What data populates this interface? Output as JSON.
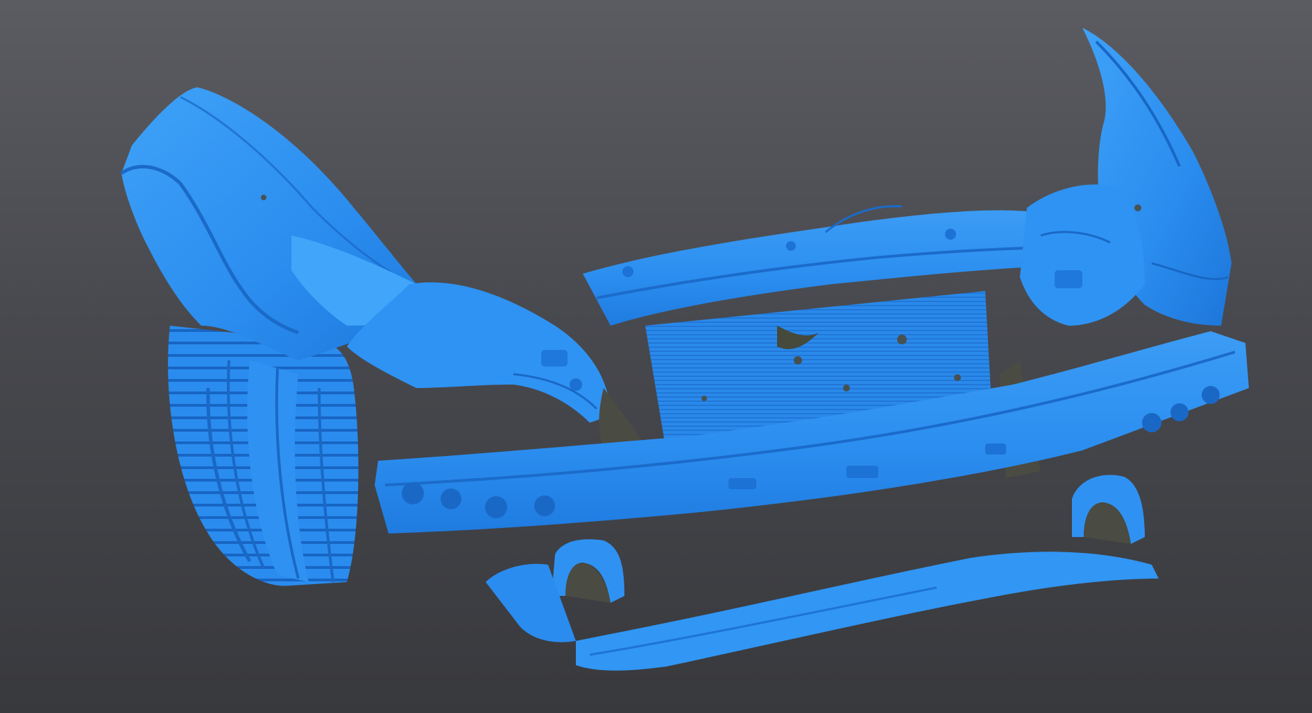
{
  "viewport": {
    "background_top": "#5b5c61",
    "background_bottom": "#38393d"
  },
  "model": {
    "kind": "3D scan mesh of damaged vehicle front end",
    "surface_color": "#2c8ff0",
    "highlight_color": "#5ab4ff",
    "shadow_color": "#1562b8",
    "cavity_color": "#4a4b42",
    "parts": [
      "fender-left",
      "tire-left",
      "headlight-left",
      "radiator-support",
      "radiator-core",
      "bumper-reinforcement-bar",
      "fender-right",
      "headlight-right",
      "tow-hook-bracket-left",
      "tow-hook-bracket-right",
      "lower-splash-shield"
    ]
  }
}
